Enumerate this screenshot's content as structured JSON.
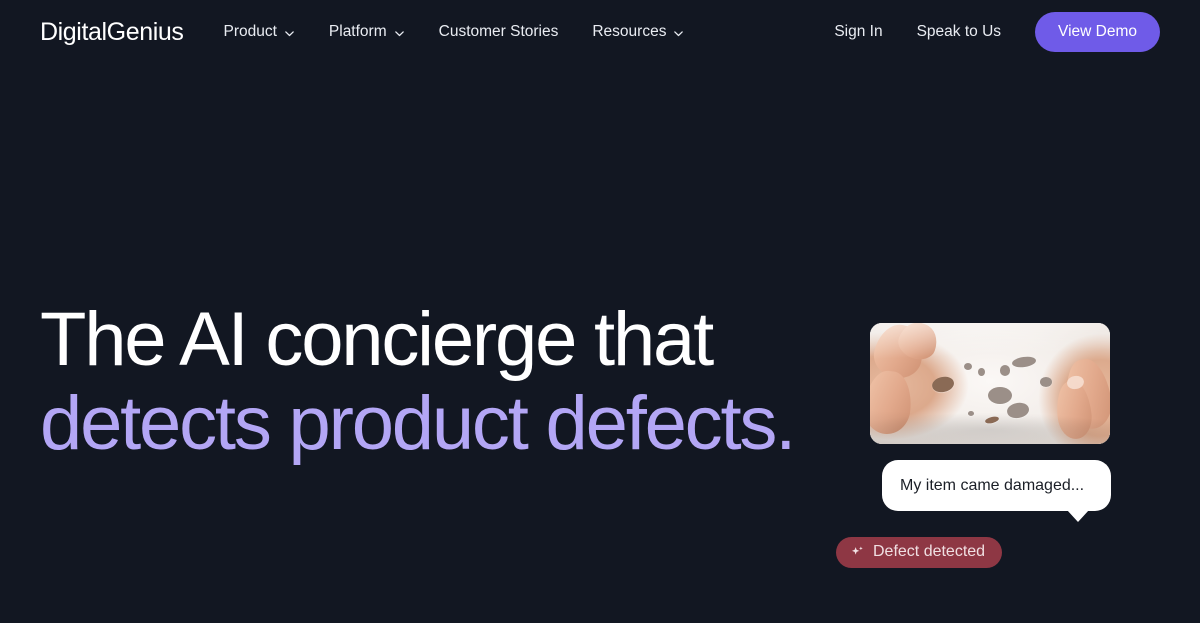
{
  "theme": {
    "background": "#121722",
    "accent_purple": "#6f5be8",
    "headline_purple": "#b3a6f5",
    "badge_red": "#8e3744",
    "text_light": "#e9ecf2"
  },
  "navbar": {
    "logo": "DigitalGenius",
    "links": [
      {
        "label": "Product",
        "has_caret": true
      },
      {
        "label": "Platform",
        "has_caret": true
      },
      {
        "label": "Customer Stories",
        "has_caret": false
      },
      {
        "label": "Resources",
        "has_caret": true
      }
    ],
    "sign_in": "Sign In",
    "speak_to_us": "Speak to Us",
    "cta": "View Demo"
  },
  "hero": {
    "headline_line1": "The AI concierge that",
    "headline_line2": "detects product defects."
  },
  "visual": {
    "photo_alt": "Hands holding a white garment with holes",
    "chat_message": "My item came damaged...",
    "badge_label": "Defect detected",
    "badge_icon": "sparkle-icon"
  }
}
